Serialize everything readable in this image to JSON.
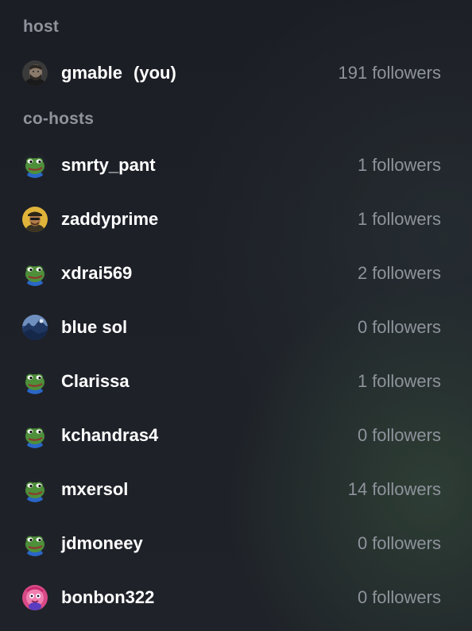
{
  "host_section": {
    "label": "host",
    "user": {
      "name": "gmable",
      "you_tag": "(you)",
      "follower_count": "191",
      "follower_word": "followers",
      "avatar_icon": "person-photo-icon"
    }
  },
  "cohost_section": {
    "label": "co-hosts",
    "users": [
      {
        "name": "smrty_pant",
        "follower_count": "1",
        "follower_word": "followers",
        "avatar_icon": "frog-icon"
      },
      {
        "name": "zaddyprime",
        "follower_count": "1",
        "follower_word": "followers",
        "avatar_icon": "yellow-portrait-icon"
      },
      {
        "name": "xdrai569",
        "follower_count": "2",
        "follower_word": "followers",
        "avatar_icon": "frog-icon"
      },
      {
        "name": "blue sol",
        "follower_count": "0",
        "follower_word": "followers",
        "avatar_icon": "blue-landscape-icon"
      },
      {
        "name": "Clarissa",
        "follower_count": "1",
        "follower_word": "followers",
        "avatar_icon": "frog-icon"
      },
      {
        "name": "kchandras4",
        "follower_count": "0",
        "follower_word": "followers",
        "avatar_icon": "frog-icon"
      },
      {
        "name": "mxersol",
        "follower_count": "14",
        "follower_word": "followers",
        "avatar_icon": "frog-icon"
      },
      {
        "name": "jdmoneey",
        "follower_count": "0",
        "follower_word": "followers",
        "avatar_icon": "frog-icon"
      },
      {
        "name": "bonbon322",
        "follower_count": "0",
        "follower_word": "followers",
        "avatar_icon": "pink-character-icon"
      }
    ]
  },
  "colors": {
    "background": "#1d2027",
    "label_gray": "#8f939c",
    "text_white": "#ffffff"
  }
}
